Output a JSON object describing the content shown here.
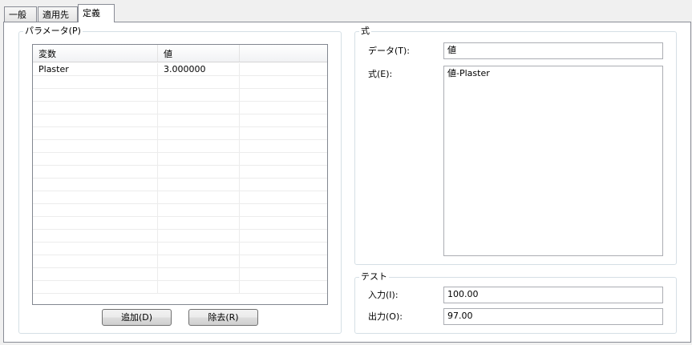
{
  "tabs": [
    {
      "label": "一般"
    },
    {
      "label": "適用先"
    },
    {
      "label": "定義"
    }
  ],
  "parameters": {
    "group_label": "パラメータ(P)",
    "columns": [
      "変数",
      "値",
      ""
    ],
    "rows": [
      [
        "Plaster",
        "3.000000",
        ""
      ],
      [
        "",
        "",
        ""
      ],
      [
        "",
        "",
        ""
      ],
      [
        "",
        "",
        ""
      ],
      [
        "",
        "",
        ""
      ],
      [
        "",
        "",
        ""
      ],
      [
        "",
        "",
        ""
      ],
      [
        "",
        "",
        ""
      ],
      [
        "",
        "",
        ""
      ],
      [
        "",
        "",
        ""
      ],
      [
        "",
        "",
        ""
      ],
      [
        "",
        "",
        ""
      ],
      [
        "",
        "",
        ""
      ],
      [
        "",
        "",
        ""
      ],
      [
        "",
        "",
        ""
      ],
      [
        "",
        "",
        ""
      ],
      [
        "",
        "",
        ""
      ],
      [
        "",
        "",
        ""
      ]
    ],
    "add_button": "追加(D)",
    "remove_button": "除去(R)"
  },
  "formula": {
    "group_label": "式",
    "data_label": "データ(T):",
    "data_value": "値",
    "expr_label": "式(E):",
    "expr_value": "値-Plaster"
  },
  "test": {
    "group_label": "テスト",
    "input_label": "入力(I):",
    "input_value": "100.00",
    "output_label": "出力(O):",
    "output_value": "97.00"
  }
}
